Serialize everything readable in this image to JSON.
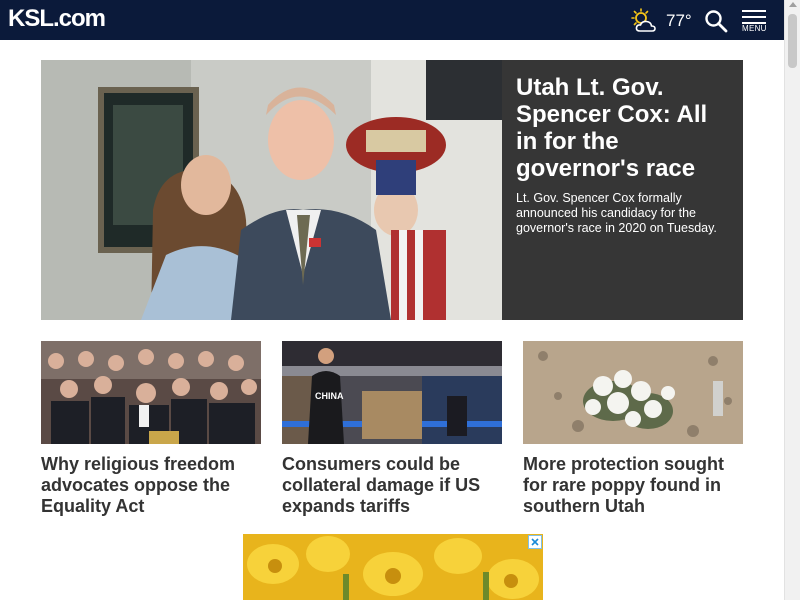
{
  "header": {
    "logo_main": "KSL",
    "logo_suffix": ".com",
    "weather_icon": "partly-cloudy-icon",
    "temperature": "77°",
    "search_icon": "search-icon",
    "menu_label": "MENU"
  },
  "hero": {
    "title": "Utah Lt. Gov. Spencer Cox: All in for the governor's race",
    "summary": "Lt. Gov. Spencer Cox formally announced his candidacy for the governor's race in 2020 on Tuesday."
  },
  "cards": [
    {
      "title": "Why religious freedom advocates oppose the Equality Act"
    },
    {
      "title": "Consumers could be collateral damage if US expands tariffs",
      "shirt_text": "CHINA"
    },
    {
      "title": "More protection sought for rare poppy found in southern Utah"
    }
  ],
  "colors": {
    "header_bg": "#0b1a3a",
    "hero_panel_bg": "#363636",
    "weather_sun": "#f5c518",
    "card_title": "#333333"
  }
}
